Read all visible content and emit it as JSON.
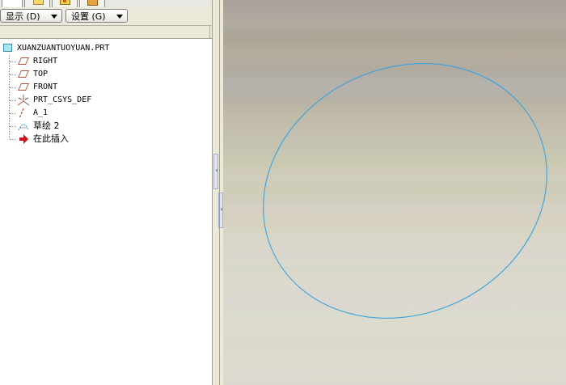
{
  "toolbar": {
    "show_label": "显示 (D)",
    "settings_label": "设置 (G)"
  },
  "tabs": [
    {
      "icon": "model-tree-tab-icon"
    },
    {
      "icon": "folder-icon"
    },
    {
      "icon": "layer-icon"
    },
    {
      "icon": "favorites-icon"
    }
  ],
  "tree": {
    "root": "XUANZUANTUOYUAN.PRT",
    "items": [
      {
        "label": "RIGHT",
        "icon": "datum-plane-icon"
      },
      {
        "label": "TOP",
        "icon": "datum-plane-icon"
      },
      {
        "label": "FRONT",
        "icon": "datum-plane-icon"
      },
      {
        "label": "PRT_CSYS_DEF",
        "icon": "coordinate-system-icon"
      },
      {
        "label": "A_1",
        "icon": "datum-axis-icon"
      },
      {
        "label": "草绘 2",
        "icon": "sketch-icon"
      },
      {
        "label": "在此插入",
        "icon": "insert-here-arrow-icon"
      }
    ]
  },
  "splitter": {
    "collapse_glyph": "‹",
    "expand_glyph": "›"
  },
  "colors": {
    "sketch_curve": "#3aa3e0",
    "datum_icon": "#a8543a",
    "insert_arrow": "#d2141c",
    "panel_bg": "#ece9d8"
  }
}
